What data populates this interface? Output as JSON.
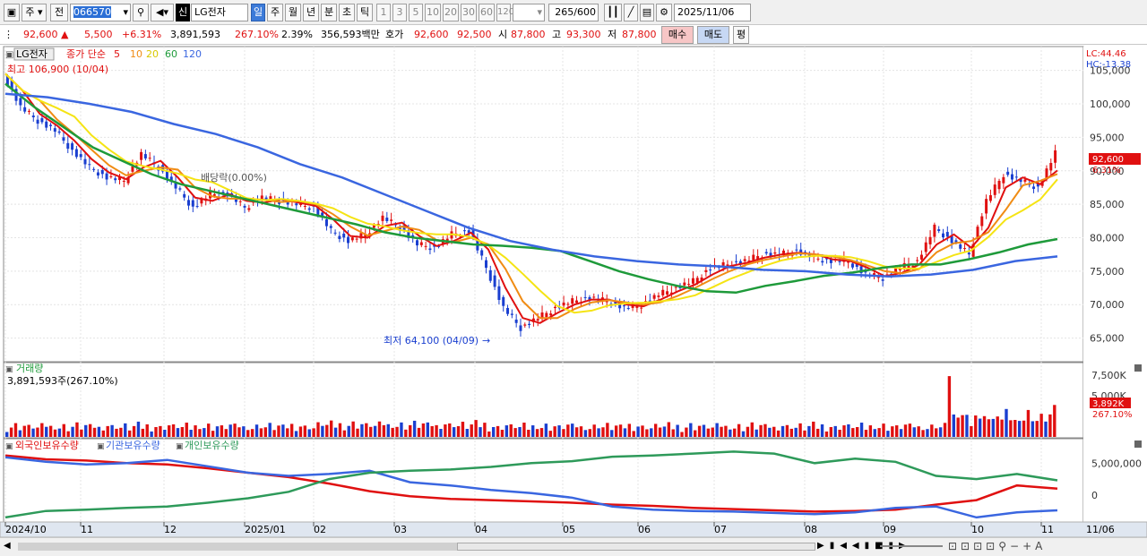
{
  "toolbar": {
    "type_label": "주",
    "prev_label": "전",
    "code_value": "066570",
    "stock_name": "LG전자",
    "new_label": "신",
    "periods": [
      "일",
      "주",
      "월",
      "년",
      "분",
      "초",
      "틱"
    ],
    "intervals": [
      "1",
      "3",
      "5",
      "10",
      "20",
      "30",
      "60",
      "120"
    ],
    "count_value": "265",
    "count_total": "/600",
    "date_value": "2025/11/06"
  },
  "quote": {
    "price": "92,600",
    "change": "5,500",
    "change_pct": "+6.31%",
    "volume": "3,891,593",
    "volume_ratio": "267.10%",
    "turnover": "2.39%",
    "amount": "356,593백만",
    "bid_label": "호가",
    "ask": "92,600",
    "bid": "92,500",
    "open_label": "시",
    "open": "87,800",
    "high_label": "고",
    "high": "93,300",
    "low_label": "저",
    "low": "87,800",
    "buy_label": "매수",
    "sell_label": "매도",
    "eval_label": "평"
  },
  "price_panel": {
    "name": "LG전자",
    "legend_prefix": "종가 단순",
    "ma_periods": [
      "5",
      "10",
      "20",
      "60",
      "120"
    ],
    "high_note": "최고 106,900 (10/04)",
    "low_note": "최저 64,100 (04/09)",
    "div_note": "배당락(0.00%)",
    "lc": "LC:44.46",
    "hc": "HC:-13.38",
    "last_price_tag": "92,600",
    "last_pct_tag": "6.31%",
    "y_ticks": [
      "105,000",
      "100,000",
      "95,000",
      "90,000",
      "85,000",
      "80,000",
      "75,000",
      "70,000",
      "65,000"
    ]
  },
  "volume_panel": {
    "title": "거래량",
    "value": "3,891,593주(267.10%)",
    "y_ticks": [
      "7,500K",
      "5,000K"
    ],
    "last_tag": "3,892K",
    "last_pct": "267.10%"
  },
  "holdings_panel": {
    "series": [
      "외국인보유수량",
      "기관보유수량",
      "개인보유수량"
    ],
    "y_ticks": [
      "5,000,000",
      "0"
    ]
  },
  "x_ticks": [
    "2024/10",
    "11",
    "12",
    "2025/01",
    "02",
    "03",
    "04",
    "05",
    "06",
    "07",
    "08",
    "09",
    "10",
    "11",
    "11/06"
  ],
  "colors": {
    "up": "#e01010",
    "down": "#1a3fd0",
    "ma5": "#e01010",
    "ma10": "#f08c14",
    "ma20": "#f5e414",
    "ma60": "#1e9a3a",
    "ma120": "#3a66e0",
    "foreign": "#e01010",
    "institution": "#3a66e0",
    "individual": "#2e9a5a"
  },
  "chart_data": [
    {
      "type": "candlestick",
      "title": "LG전자",
      "series": [
        {
          "name": "종가 단순 5"
        },
        {
          "name": "10"
        },
        {
          "name": "20"
        },
        {
          "name": "60"
        },
        {
          "name": "120"
        }
      ],
      "highest": {
        "value": 106900,
        "date": "10/04"
      },
      "lowest": {
        "value": 64100,
        "date": "04/09"
      },
      "close_approx": [
        104500,
        99500,
        97500,
        96000,
        93000,
        90500,
        89000,
        88500,
        92500,
        90500,
        87500,
        84500,
        86500,
        86500,
        84500,
        86000,
        85500,
        85000,
        84500,
        81000,
        79500,
        80500,
        83000,
        81500,
        79000,
        78500,
        80500,
        81000,
        75500,
        69500,
        66500,
        68000,
        69500,
        70500,
        71000,
        70500,
        69500,
        70000,
        71500,
        72500,
        73500,
        75500,
        76000,
        76500,
        77500,
        77500,
        78000,
        77000,
        76500,
        76500,
        74500,
        74000,
        75500,
        76500,
        81500,
        79500,
        77500,
        85500,
        89500,
        88500,
        87500,
        92600
      ],
      "ma60_approx": [
        103000,
        99500,
        96500,
        93500,
        91500,
        89500,
        88000,
        87000,
        86000,
        85000,
        84000,
        83000,
        82000,
        80800,
        80000,
        79500,
        79000,
        78800,
        78500,
        78000,
        76500,
        75000,
        73800,
        72800,
        72000,
        71800,
        72800,
        73500,
        74300,
        74800,
        75500,
        76000,
        76000,
        76800,
        77800,
        79000,
        79800
      ],
      "ma120_approx": [
        101500,
        101000,
        100000,
        98800,
        97000,
        95500,
        93500,
        91000,
        89000,
        86500,
        84000,
        81500,
        79500,
        78200,
        77200,
        76500,
        76000,
        75700,
        75200,
        75000,
        74500,
        74200,
        74500,
        75200,
        76500,
        77200
      ],
      "y_range": [
        62000,
        107500
      ]
    },
    {
      "type": "bar",
      "title": "거래량",
      "last_value": 3891593,
      "last_ratio_pct": 267.1,
      "ylim": [
        0,
        8500000
      ]
    },
    {
      "type": "line",
      "series": [
        {
          "name": "외국인보유수량",
          "values": [
            6200000,
            5600000,
            5400000,
            5000000,
            4800000,
            4200000,
            3500000,
            2800000,
            1800000,
            600000,
            -200000,
            -600000,
            -800000,
            -1000000,
            -1200000,
            -1500000,
            -1700000,
            -2000000,
            -2200000,
            -2400000,
            -2600000,
            -2500000,
            -2300000,
            -1500000,
            -800000,
            1500000,
            1000000
          ]
        },
        {
          "name": "기관보유수량",
          "values": [
            5900000,
            5200000,
            4800000,
            5000000,
            5500000,
            4500000,
            3500000,
            3000000,
            3300000,
            3800000,
            2000000,
            1500000,
            800000,
            300000,
            -400000,
            -1800000,
            -2300000,
            -2500000,
            -2600000,
            -2800000,
            -3000000,
            -2700000,
            -2000000,
            -1800000,
            -3500000,
            -2700000,
            -2400000
          ]
        },
        {
          "name": "개인보유수량",
          "values": [
            -3500000,
            -2500000,
            -2300000,
            -2000000,
            -1800000,
            -1200000,
            -500000,
            500000,
            2500000,
            3500000,
            3800000,
            4000000,
            4400000,
            5000000,
            5300000,
            6000000,
            6200000,
            6500000,
            6800000,
            6500000,
            5000000,
            5700000,
            5200000,
            3000000,
            2500000,
            3300000,
            2300000
          ]
        }
      ],
      "ylim": [
        -3800000,
        7000000
      ]
    }
  ]
}
